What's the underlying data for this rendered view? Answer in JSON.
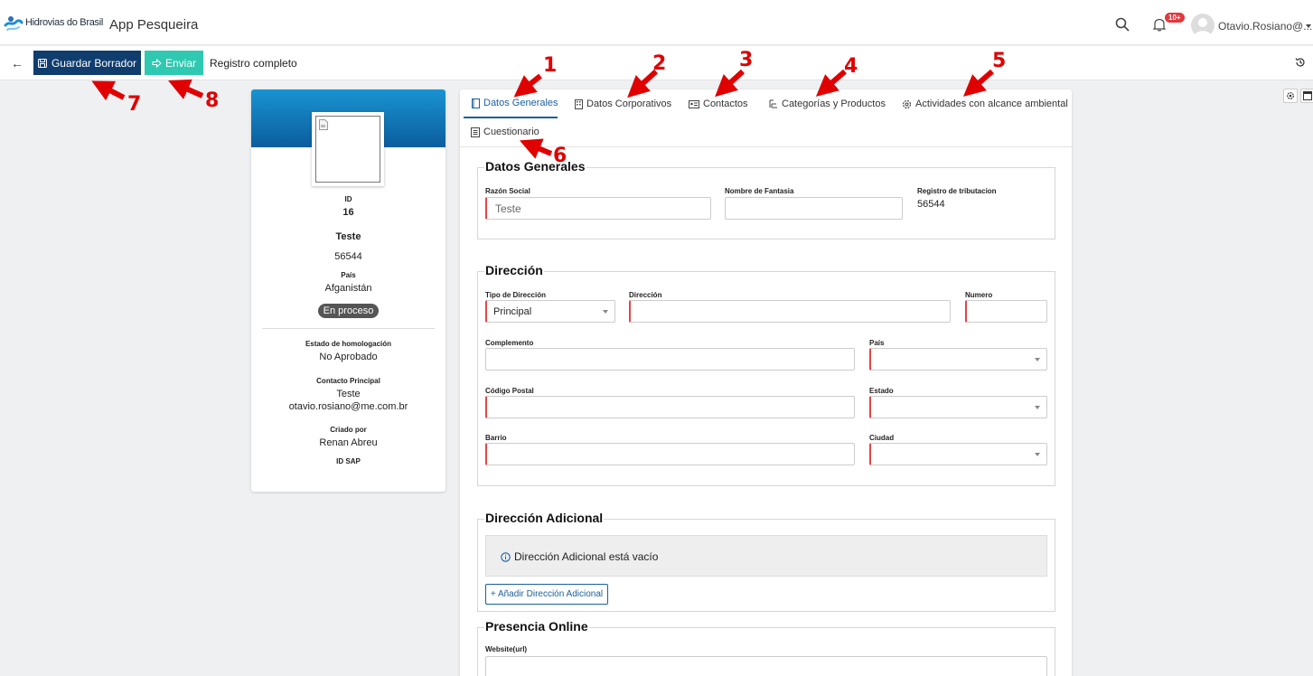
{
  "header": {
    "logo_text": "Hidrovias do Brasil",
    "app_title": "App Pesqueira",
    "notif_count": "10+",
    "user_name": "Otavio.Rosiano@..."
  },
  "actionbar": {
    "save_label": "Guardar Borrador",
    "send_label": "Enviar",
    "status": "Registro completo"
  },
  "profile": {
    "id_label": "ID",
    "id_value": "16",
    "name": "Teste",
    "tax_id": "56544",
    "country_label": "País",
    "country_value": "Afganistán",
    "status_pill": "En proceso",
    "homolog_label": "Estado de homologación",
    "homolog_value": "No Aprobado",
    "contact_label": "Contacto Principal",
    "contact_name": "Teste",
    "contact_email": "otavio.rosiano@me.com.br",
    "created_label": "Criado por",
    "created_value": "Renan Abreu",
    "sap_label": "ID SAP"
  },
  "tabs": [
    {
      "label": "Datos Generales",
      "icon": "book-icon"
    },
    {
      "label": "Datos Corporativos",
      "icon": "building-icon"
    },
    {
      "label": "Contactos",
      "icon": "id-card-icon"
    },
    {
      "label": "Categorías y Productos",
      "icon": "tree-icon"
    },
    {
      "label": "Actividades con alcance ambiental",
      "icon": "gear-icon"
    },
    {
      "label": "Cuestionario",
      "icon": "list-icon"
    }
  ],
  "datos_generales": {
    "title": "Datos Generales",
    "razon_label": "Razón Social",
    "razon_placeholder": "Teste",
    "fantasia_label": "Nombre de Fantasia",
    "tributacion_label": "Registro de tributacion",
    "tributacion_value": "56544"
  },
  "direccion": {
    "title": "Dirección",
    "tipo_label": "Tipo de Dirección",
    "tipo_value": "Principal",
    "direccion_label": "Dirección",
    "numero_label": "Numero",
    "complemento_label": "Complemento",
    "pais_label": "País",
    "postal_label": "Código Postal",
    "estado_label": "Estado",
    "barrio_label": "Barrio",
    "ciudad_label": "Ciudad"
  },
  "direccion_adicional": {
    "title": "Dirección Adicional",
    "empty_msg": "Dirección Adicional está vacío",
    "add_label": "+ Añadir Dirección Adicional"
  },
  "presencia": {
    "title": "Presencia Online",
    "website_label": "Website(url)"
  },
  "annotations": [
    "1",
    "2",
    "3",
    "4",
    "5",
    "6",
    "7",
    "8"
  ],
  "colors": {
    "primary": "#0f3d6e",
    "send": "#2fc9b2",
    "accent_blue": "#1c5fa0",
    "required": "#e04747",
    "annotation": "#e00000"
  }
}
